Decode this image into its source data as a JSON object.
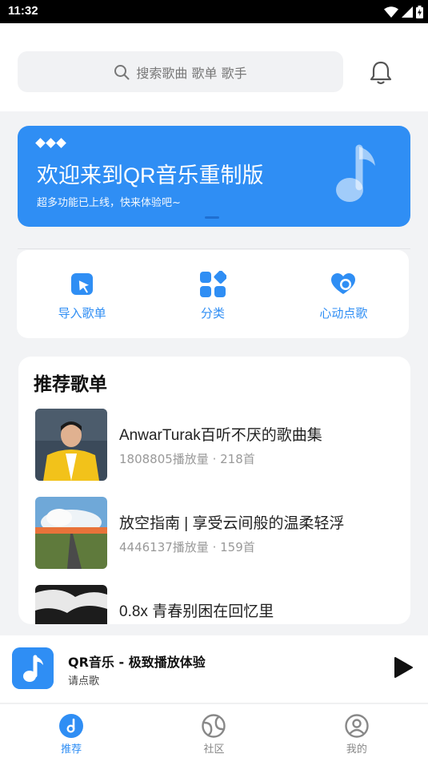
{
  "status_bar": {
    "time": "11:32"
  },
  "search": {
    "placeholder": "搜索歌曲 歌单 歌手"
  },
  "banner": {
    "title": "欢迎来到QR音乐重制版",
    "subtitle": "超多功能已上线，快来体验吧~"
  },
  "quick_actions": [
    {
      "label": "导入歌单",
      "icon": "import-playlist-icon"
    },
    {
      "label": "分类",
      "icon": "category-icon"
    },
    {
      "label": "心动点歌",
      "icon": "heart-pick-icon"
    }
  ],
  "playlists": {
    "title": "推荐歌单",
    "items": [
      {
        "name": "AnwarTurak百听不厌的歌曲集",
        "meta": "1808805播放量 · 218首"
      },
      {
        "name": "放空指南 | 享受云间般的温柔轻浮",
        "meta": "4446137播放量 · 159首"
      },
      {
        "name": "0.8x 青春别困在回忆里",
        "meta": ""
      }
    ]
  },
  "player": {
    "title": "QR音乐 - 极致播放体验",
    "subtitle": "请点歌"
  },
  "tabs": [
    {
      "label": "推荐",
      "icon": "recommend-icon",
      "active": true
    },
    {
      "label": "社区",
      "icon": "community-icon",
      "active": false
    },
    {
      "label": "我的",
      "icon": "profile-icon",
      "active": false
    }
  ],
  "colors": {
    "accent": "#2f8ef4",
    "background": "#f2f3f5"
  }
}
